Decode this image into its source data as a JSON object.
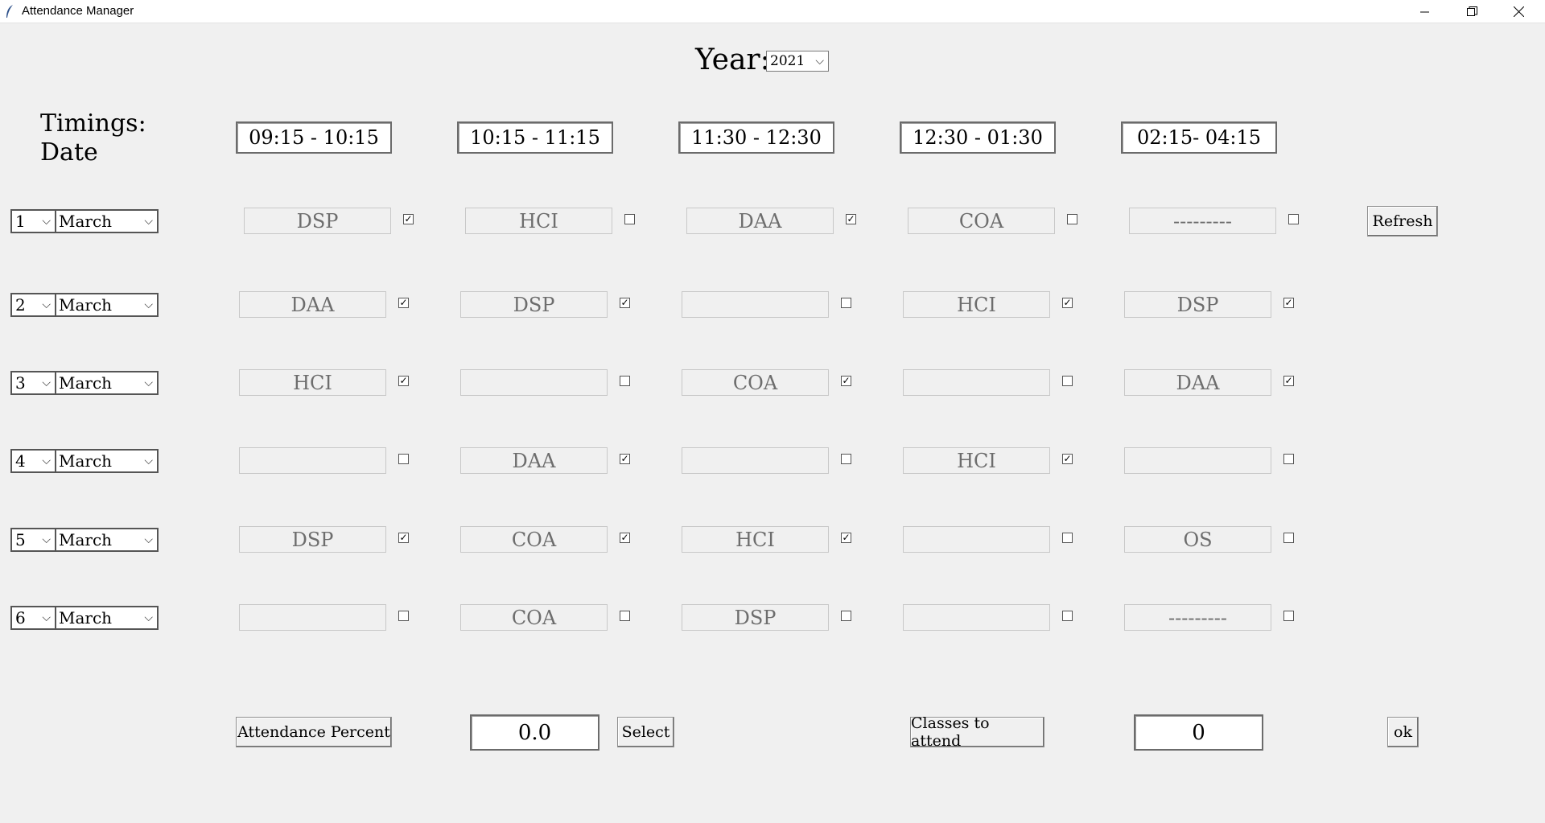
{
  "window": {
    "title": "Attendance Manager"
  },
  "year": {
    "label": "Year:",
    "value": "2021"
  },
  "timings_label": "Timings:",
  "date_label": "Date",
  "timings": [
    "09:15 - 10:15",
    "10:15 - 11:15",
    "11:30 - 12:30",
    "12:30 - 01:30",
    "02:15- 04:15"
  ],
  "rows": [
    {
      "day": "1",
      "month": "March",
      "slots": [
        {
          "subject": "DSP",
          "checked": true
        },
        {
          "subject": "HCI",
          "checked": false
        },
        {
          "subject": "DAA",
          "checked": true
        },
        {
          "subject": "COA",
          "checked": false
        },
        {
          "subject": "---------",
          "checked": false
        }
      ]
    },
    {
      "day": "2",
      "month": "March",
      "slots": [
        {
          "subject": "DAA",
          "checked": true
        },
        {
          "subject": "DSP",
          "checked": true
        },
        {
          "subject": "",
          "checked": false
        },
        {
          "subject": "HCI",
          "checked": true
        },
        {
          "subject": "DSP",
          "checked": true
        }
      ]
    },
    {
      "day": "3",
      "month": "March",
      "slots": [
        {
          "subject": "HCI",
          "checked": true
        },
        {
          "subject": "",
          "checked": false
        },
        {
          "subject": "COA",
          "checked": true
        },
        {
          "subject": "",
          "checked": false
        },
        {
          "subject": "DAA",
          "checked": true
        }
      ]
    },
    {
      "day": "4",
      "month": "March",
      "slots": [
        {
          "subject": "",
          "checked": false
        },
        {
          "subject": "DAA",
          "checked": true
        },
        {
          "subject": "",
          "checked": false
        },
        {
          "subject": "HCI",
          "checked": true
        },
        {
          "subject": "",
          "checked": false
        }
      ]
    },
    {
      "day": "5",
      "month": "March",
      "slots": [
        {
          "subject": "DSP",
          "checked": true
        },
        {
          "subject": "COA",
          "checked": true
        },
        {
          "subject": "HCI",
          "checked": true
        },
        {
          "subject": "",
          "checked": false
        },
        {
          "subject": "OS",
          "checked": false
        }
      ]
    },
    {
      "day": "6",
      "month": "March",
      "slots": [
        {
          "subject": "",
          "checked": false
        },
        {
          "subject": "COA",
          "checked": false
        },
        {
          "subject": "DSP",
          "checked": false
        },
        {
          "subject": "",
          "checked": false
        },
        {
          "subject": "---------",
          "checked": false
        }
      ]
    }
  ],
  "buttons": {
    "refresh": "Refresh",
    "attendance_percent": "Attendance Percent",
    "select": "Select",
    "classes_to_attend": "Classes to attend",
    "ok": "ok"
  },
  "outputs": {
    "attendance_percent": "0.0",
    "classes_to_attend": "0"
  }
}
